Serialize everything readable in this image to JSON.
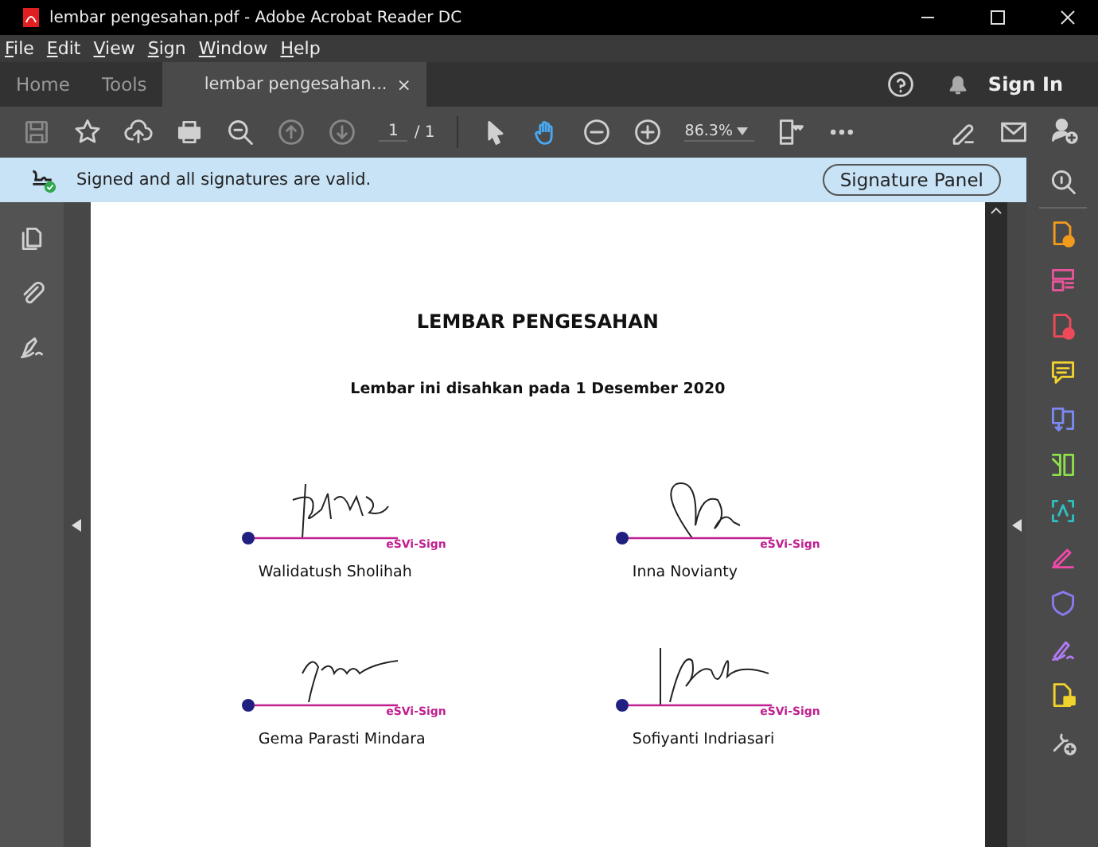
{
  "window": {
    "title": "lembar pengesahan.pdf - Adobe Acrobat Reader DC"
  },
  "menu": [
    "File",
    "Edit",
    "View",
    "Sign",
    "Window",
    "Help"
  ],
  "tabs": [
    {
      "label": "Home",
      "selected": false
    },
    {
      "label": "Tools",
      "selected": false
    },
    {
      "label": "lembar pengesahan...",
      "selected": true,
      "close": "×"
    }
  ],
  "sign_in": "Sign In",
  "toolbar": {
    "page": "1",
    "page_total": "/ 1",
    "zoom": "86.3%",
    "hand_tool_selected": true
  },
  "signature_bar": {
    "message": "Signed and all signatures are valid.",
    "button": "Signature Panel"
  },
  "document": {
    "title": "LEMBAR PENGESAHAN",
    "subtitle": "Lembar ini disahkan pada 1 Desember 2020",
    "signatures": [
      {
        "name": "Walidatush Sholihah",
        "stamp": "eSVi-Sign"
      },
      {
        "name": "Inna Novianty",
        "stamp": "eSVi-Sign"
      },
      {
        "name": "Gema Parasti Mindara",
        "stamp": "eSVi-Sign"
      },
      {
        "name": "Sofiyanti Indriasari",
        "stamp": "eSVi-Sign"
      }
    ]
  }
}
